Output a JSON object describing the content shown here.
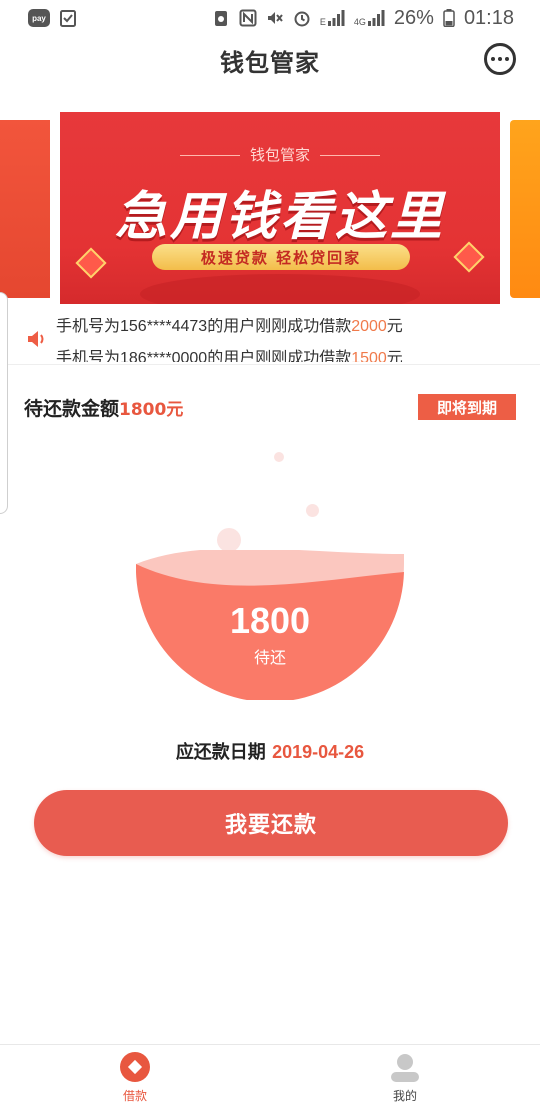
{
  "status_bar": {
    "pay_label": "pay",
    "network_e": "E",
    "network_4g": "4G",
    "battery": "26%",
    "time": "01:18"
  },
  "header": {
    "title": "钱包管家"
  },
  "banner": {
    "subtitle": "钱包管家",
    "headline": "急用钱看这里",
    "tagline": "极速贷款  轻松贷回家"
  },
  "notice": {
    "line1_prefix": "手机号为156****4473的用户刚刚成功借款",
    "line1_amount": "2000",
    "line1_suffix": "元",
    "line2_prefix": "手机号为186****0000的用户刚刚成功借款",
    "line2_amount": "1500",
    "line2_suffix": "元"
  },
  "pending": {
    "label": "待还款金额",
    "amount": "1800元",
    "badge": "即将到期"
  },
  "gauge": {
    "value": "1800",
    "caption": "待还",
    "fill_fraction": 0.75
  },
  "due": {
    "label": "应还款日期 ",
    "date": "2019-04-26"
  },
  "repay_button": {
    "label": "我要还款"
  },
  "bottom_nav": {
    "items": [
      {
        "label": "借款",
        "icon": "loan-icon",
        "active": true
      },
      {
        "label": "我的",
        "icon": "profile-icon",
        "active": false
      }
    ]
  },
  "colors": {
    "accent": "#e8573f",
    "button": "#e85c50",
    "gauge_fill": "#fa7a68",
    "banner_red": "#e43334"
  }
}
